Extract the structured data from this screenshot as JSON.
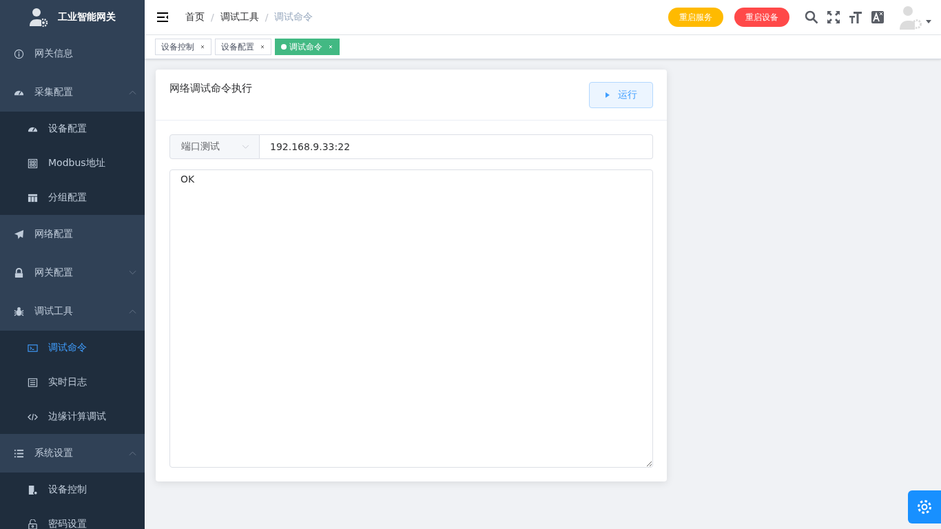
{
  "sidebar": {
    "title": "工业智能网关",
    "menu": [
      {
        "label": "网关信息"
      },
      {
        "label": "采集配置",
        "expanded": true,
        "children": [
          {
            "label": "设备配置",
            "selected": false
          },
          {
            "label": "Modbus地址",
            "selected": false
          },
          {
            "label": "分组配置",
            "selected": false
          }
        ]
      },
      {
        "label": "网络配置"
      },
      {
        "label": "网关配置",
        "expanded": false
      },
      {
        "label": "调试工具",
        "expanded": true,
        "children": [
          {
            "label": "调试命令",
            "selected": true
          },
          {
            "label": "实时日志",
            "selected": false
          },
          {
            "label": "边缘计算调试",
            "selected": false
          }
        ]
      },
      {
        "label": "系统设置",
        "expanded": true,
        "children": [
          {
            "label": "设备控制",
            "selected": false
          },
          {
            "label": "密码设置",
            "selected": false
          }
        ]
      }
    ]
  },
  "breadcrumb": [
    {
      "label": "首页"
    },
    {
      "separator": "/",
      "label": "调试工具"
    },
    {
      "separator": "/",
      "label": "调试命令"
    }
  ],
  "header_buttons": [
    {
      "label": "重启服务",
      "kind": "warning"
    },
    {
      "label": "重启设备",
      "kind": "danger"
    }
  ],
  "tabs": [
    {
      "label": "设备控制",
      "selected": false
    },
    {
      "label": "设备配置",
      "selected": false
    },
    {
      "label": "调试命令",
      "selected": true
    }
  ],
  "card": {
    "title": "网络调试命令执行",
    "run_button": "运行",
    "command_type": "端口测试",
    "address": "192.168.9.33:22",
    "output": "OK"
  }
}
